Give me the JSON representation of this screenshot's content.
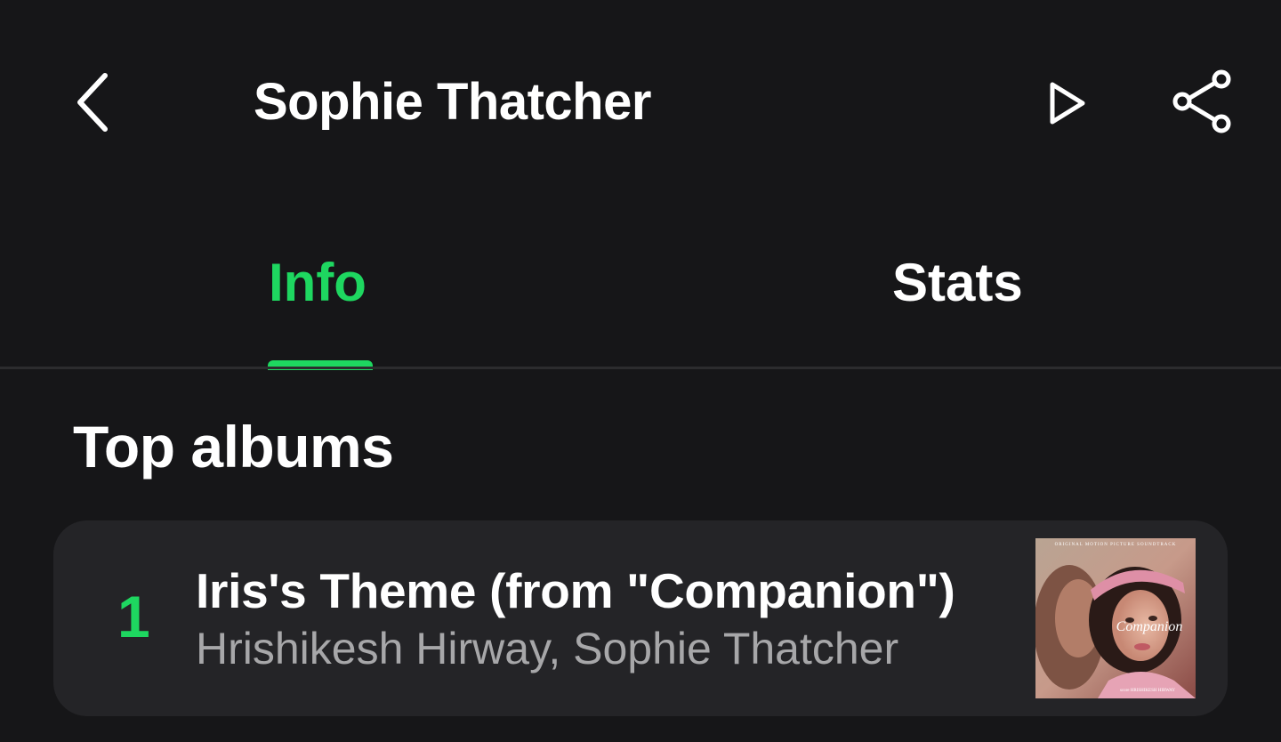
{
  "header": {
    "title": "Sophie Thatcher",
    "back_icon": "chevron-left-icon",
    "play_icon": "play-icon",
    "share_icon": "share-icon"
  },
  "tabs": [
    {
      "label": "Info",
      "selected": true
    },
    {
      "label": "Stats",
      "selected": false
    }
  ],
  "section": {
    "title": "Top albums"
  },
  "albums": [
    {
      "rank": "1",
      "title": "Iris's Theme (from \"Companion\")",
      "artists": "Hrishikesh Hirway, Sophie Thatcher",
      "cover": {
        "script_text": "Companion",
        "top_text": "ORIGINAL MOTION PICTURE SOUNDTRACK",
        "bottom_text": "score HRISHIKESH HIRWAY"
      }
    }
  ],
  "colors": {
    "background": "#161618",
    "accent": "#1ed760",
    "card": "#242427",
    "secondary_text": "#a7a7a9"
  }
}
